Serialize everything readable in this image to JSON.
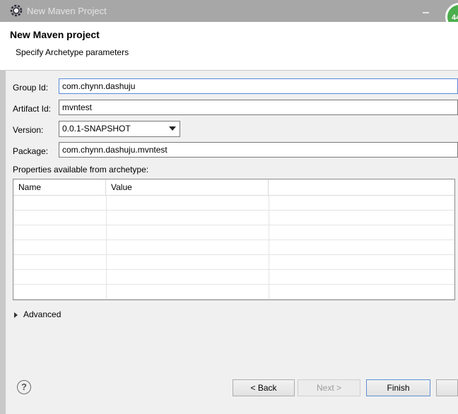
{
  "window": {
    "title": "New Maven Project",
    "badge": "44"
  },
  "header": {
    "title": "New Maven project",
    "subtitle": "Specify Archetype parameters"
  },
  "form": {
    "group_id_label": "Group Id:",
    "group_id_value": "com.chynn.dashuju",
    "artifact_id_label": "Artifact Id:",
    "artifact_id_value": "mvntest",
    "version_label": "Version:",
    "version_value": "0.0.1-SNAPSHOT",
    "package_label": "Package:",
    "package_value": "com.chynn.dashuju.mvntest"
  },
  "properties": {
    "label": "Properties available from archetype:",
    "columns": [
      "Name",
      "Value"
    ]
  },
  "advanced_label": "Advanced",
  "footer": {
    "help_symbol": "?",
    "back_label": "< Back",
    "next_label": "Next >",
    "finish_label": "Finish"
  }
}
